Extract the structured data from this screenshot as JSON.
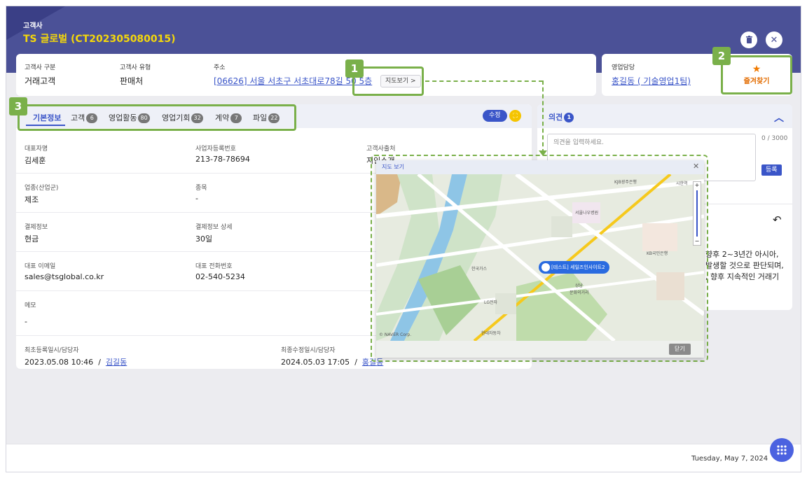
{
  "header": {
    "breadcrumb": "고객사",
    "title": "TS 글로벌 (CT202305080015)"
  },
  "info": {
    "type_label": "고객사 구분",
    "type_value": "거래고객",
    "kind_label": "고객사 유형",
    "kind_value": "판매처",
    "addr_label": "주소",
    "addr_value": "[06626] 서울 서초구 서초대로78길 50 5층",
    "map_button": "지도보기 >"
  },
  "sales": {
    "label": "영업담당",
    "value": "홍길동 ( 기술영업1팀)",
    "favorite": "즐겨찾기"
  },
  "annotations": [
    "1",
    "2",
    "3"
  ],
  "tabs": [
    {
      "label": "기본정보",
      "count": ""
    },
    {
      "label": "고객",
      "count": "6"
    },
    {
      "label": "영업활동",
      "count": "80"
    },
    {
      "label": "영업기회",
      "count": "32"
    },
    {
      "label": "계약",
      "count": "7"
    },
    {
      "label": "파일",
      "count": "22"
    }
  ],
  "edit_button": "수정",
  "fields": {
    "ceo_label": "대표자명",
    "ceo_value": "김세훈",
    "biz_label": "사업자등록번호",
    "biz_value": "213-78-78694",
    "src_label": "고객사출처",
    "src_value": "지인소개",
    "ind_label": "업종(산업군)",
    "ind_value": "제조",
    "item_label": "종목",
    "item_value": "-",
    "pay_label": "결제정보",
    "pay_value": "현금",
    "paydet_label": "결제정보 상세",
    "paydet_value": "30일",
    "email_label": "대표 이메일",
    "email_value": "sales@tsglobal.co.kr",
    "tel_label": "대표 전화번호",
    "tel_value": "02-540-5234",
    "memo_label": "메모",
    "memo_value": "-",
    "created_label": "최초등록일시/담당자",
    "created_date": "2023.05.08 10:46",
    "created_user": "김길동",
    "updated_label": "최종수정일시/담당자",
    "updated_date": "2024.05.03 17:05",
    "updated_user": "홍길동",
    "sep": "/"
  },
  "comments": {
    "title": "의견",
    "count": "1",
    "placeholder": "의견을 입력하세요.",
    "counter": "0 / 3000",
    "register": "등록",
    "text_lines": [
      "향후 2~3년간 아시아,",
      "발생할 것으로 판단되며,",
      ", 향후 지속적인 거래기"
    ]
  },
  "map_popup": {
    "title": "지도 보기",
    "pin_label": "[테스트] 세일즈인사이트2",
    "close_button": "닫기",
    "copyright": "© NAVER Corp.",
    "labels": [
      "KJB광주은행",
      "서울나우병원",
      "LG전자",
      "한국가스",
      "시한역",
      "KB국민은행",
      "상남",
      "문화의거리",
      "현대자동차"
    ]
  },
  "footer": {
    "date": "Tuesday, May 7, 2024"
  },
  "colors": {
    "header": "#4b5197",
    "title": "#f5d80a",
    "accent": "#3a55c8",
    "highlight": "#7ab04a"
  }
}
